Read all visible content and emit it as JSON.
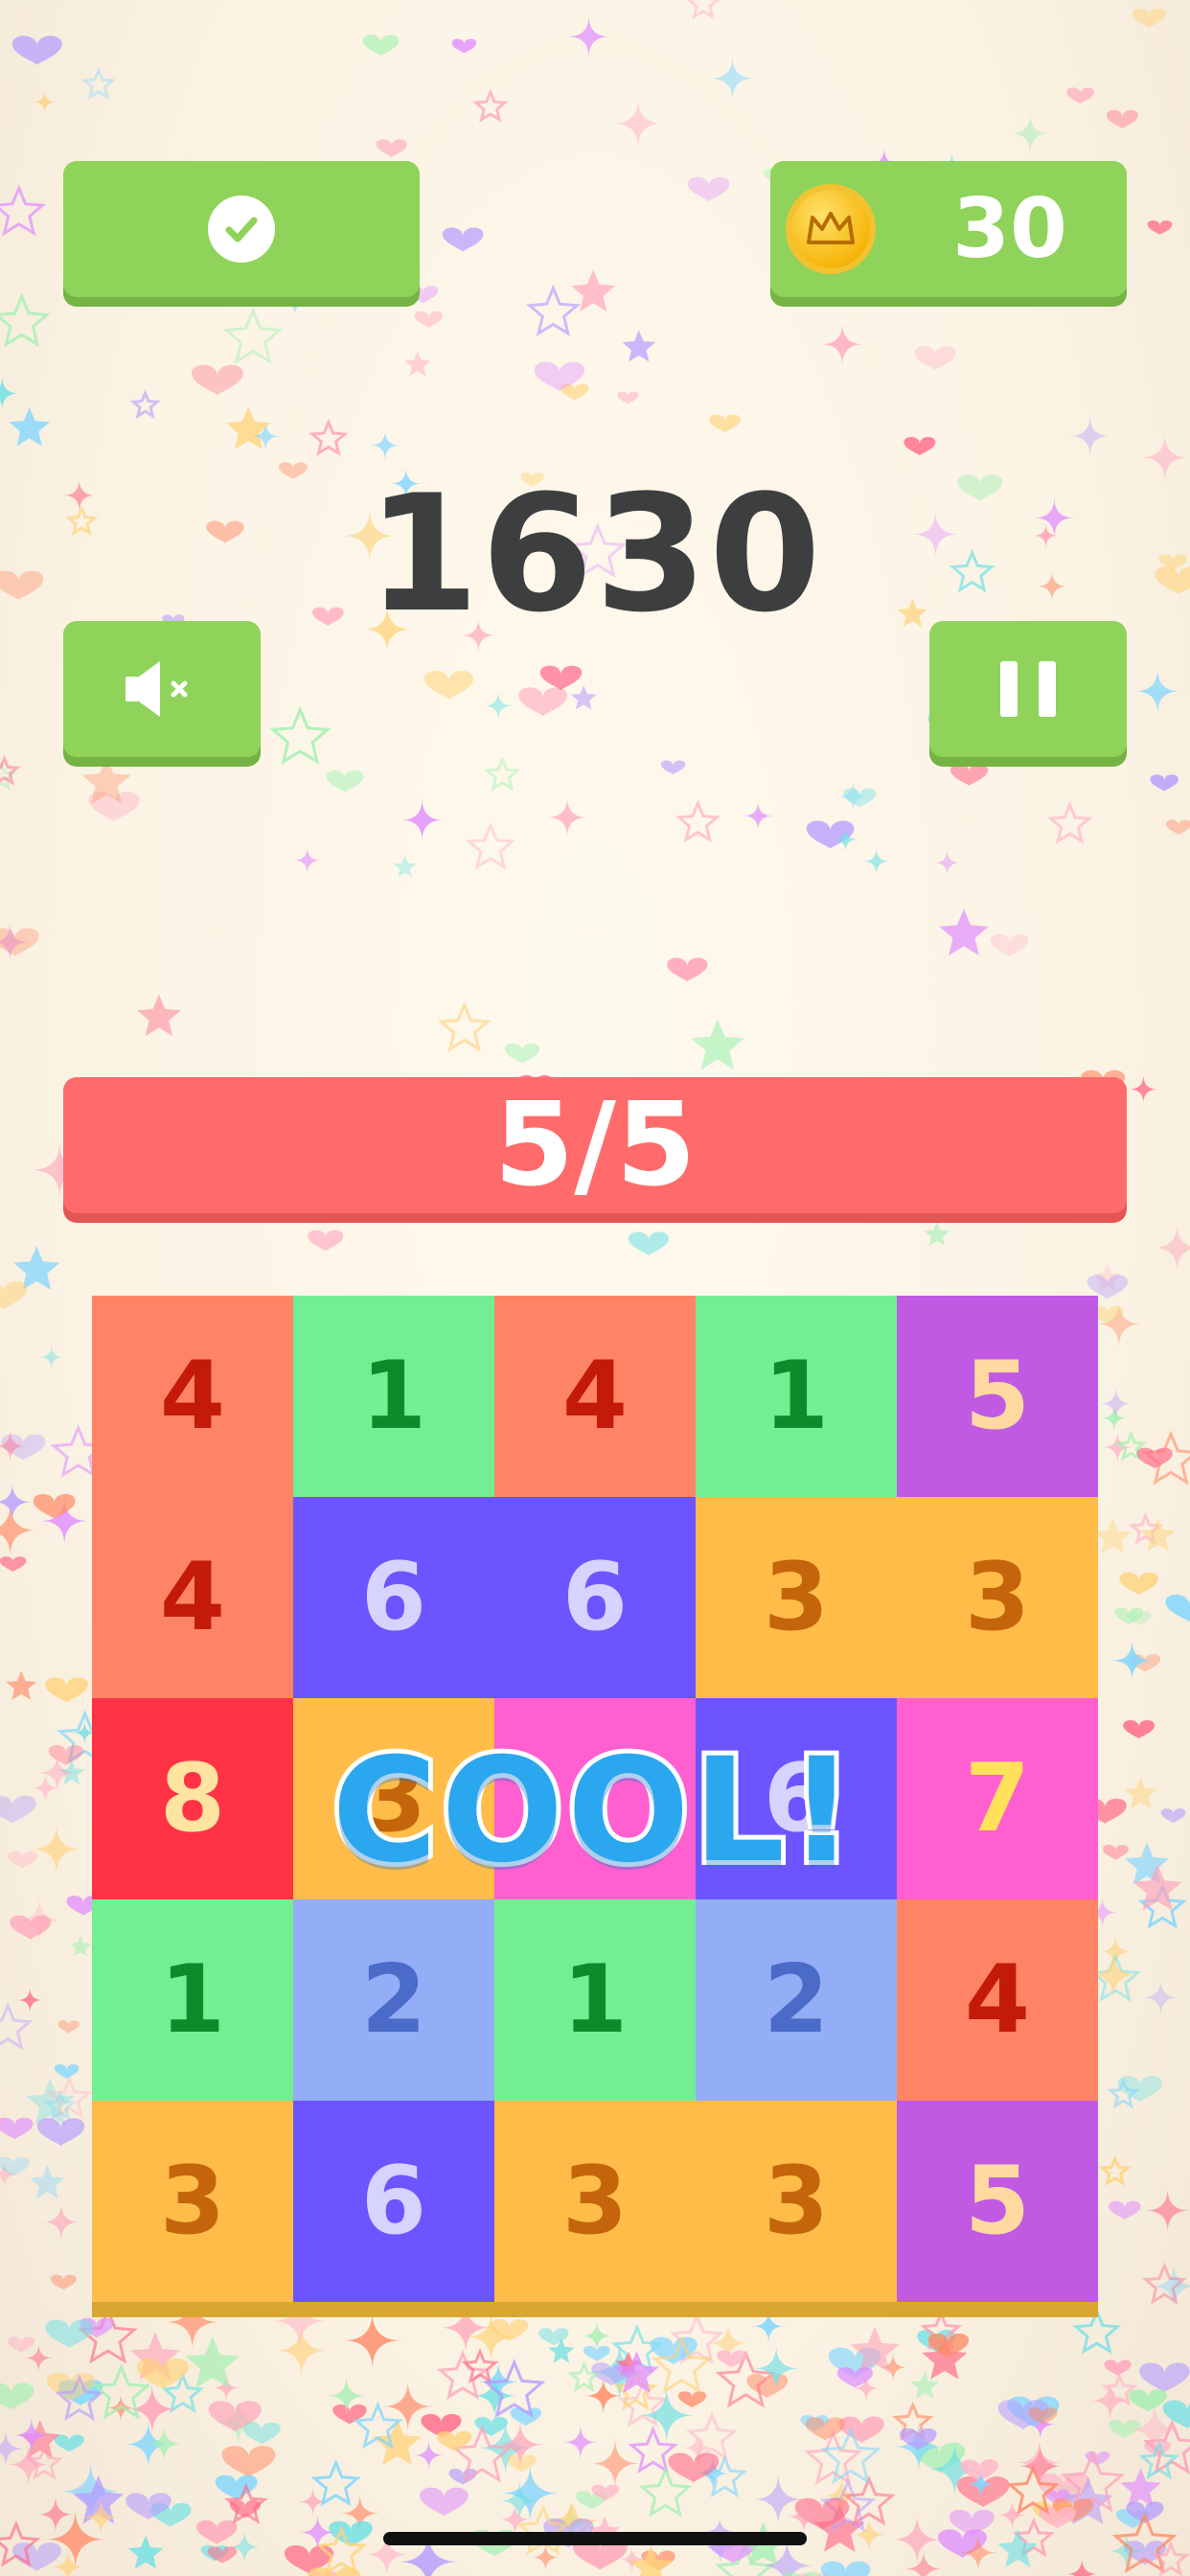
{
  "header": {
    "check_icon": "checkmark-icon",
    "coin_icon": "crown-coin-icon",
    "coins": "30"
  },
  "score": "1630",
  "controls": {
    "sound_icon": "speaker-muted-icon",
    "pause_icon": "pause-icon"
  },
  "progress": {
    "label": "5/5",
    "value": 1.0
  },
  "board": {
    "rows": [
      [
        {
          "v": "4",
          "bg": "#ff8466",
          "fg": "#c31a0a"
        },
        {
          "v": "1",
          "bg": "#72ee93",
          "fg": "#0f8a2a"
        },
        {
          "v": "4",
          "bg": "#ff8466",
          "fg": "#c31a0a"
        },
        {
          "v": "1",
          "bg": "#72ee93",
          "fg": "#0f8a2a"
        },
        {
          "v": "5",
          "bg": "#c05ae3",
          "fg": "#ffd9a0"
        }
      ],
      [
        {
          "v": "4",
          "bg": "#ff8466",
          "fg": "#c31a0a"
        },
        {
          "v": "6",
          "bg": "#6c55ff",
          "fg": "#d6d3ff"
        },
        {
          "v": "6",
          "bg": "#6c55ff",
          "fg": "#d6d3ff"
        },
        {
          "v": "3",
          "bg": "#ffbc48",
          "fg": "#c4650c"
        },
        {
          "v": "3",
          "bg": "#ffbc48",
          "fg": "#c4650c"
        }
      ],
      [
        {
          "v": "8",
          "bg": "#ff3346",
          "fg": "#ffe4a0"
        },
        {
          "v": "3",
          "bg": "#ffbc48",
          "fg": "#c4650c"
        },
        {
          "v": "",
          "bg": "#ff5fcf",
          "fg": "#ffe15a"
        },
        {
          "v": "6",
          "bg": "#6c55ff",
          "fg": "#d6d3ff"
        },
        {
          "v": "7",
          "bg": "#ff5fcf",
          "fg": "#ffe15a"
        }
      ],
      [
        {
          "v": "1",
          "bg": "#72ee93",
          "fg": "#0f8a2a"
        },
        {
          "v": "2",
          "bg": "#93aef6",
          "fg": "#4b6bc8"
        },
        {
          "v": "1",
          "bg": "#72ee93",
          "fg": "#0f8a2a"
        },
        {
          "v": "2",
          "bg": "#93aef6",
          "fg": "#4b6bc8"
        },
        {
          "v": "4",
          "bg": "#ff8466",
          "fg": "#c31a0a"
        }
      ],
      [
        {
          "v": "3",
          "bg": "#ffbc48",
          "fg": "#c4650c"
        },
        {
          "v": "6",
          "bg": "#6c55ff",
          "fg": "#d6d3ff"
        },
        {
          "v": "3",
          "bg": "#ffbc48",
          "fg": "#c4650c"
        },
        {
          "v": "3",
          "bg": "#ffbc48",
          "fg": "#c4650c"
        },
        {
          "v": "5",
          "bg": "#c05ae3",
          "fg": "#ffd9a0"
        }
      ]
    ]
  },
  "overlay": {
    "message": "COOL!"
  },
  "colors": {
    "button": "#8fd35a",
    "progress": "#ff6b6b",
    "score": "#3d3e40",
    "overlay_text": "#2aa7ef"
  }
}
